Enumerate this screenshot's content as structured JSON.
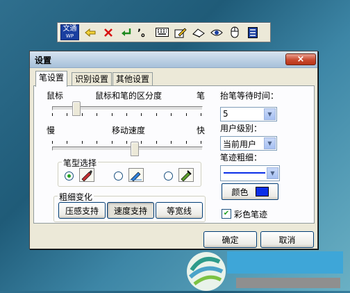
{
  "toolbar": {
    "logo_top": "文通",
    "logo_bottom": "WP",
    "icons": [
      "back-arrow-icon",
      "delete-x-icon",
      "enter-icon",
      "punctuation-icon",
      "keyboard-icon",
      "edit-icon",
      "eraser-icon",
      "eye-icon",
      "mouse-icon",
      "menu-icon"
    ]
  },
  "dialog": {
    "title": "设置",
    "close_label": "×",
    "tabs": [
      {
        "label": "笔设置",
        "active": true
      },
      {
        "label": "识别设置",
        "active": false
      },
      {
        "label": "其他设置",
        "active": false
      }
    ],
    "pen_settings": {
      "mouse_label": "鼠标",
      "distinction_label": "鼠标和笔的区分度",
      "pen_label": "笔",
      "distinction_level": 0.14,
      "slow_label": "慢",
      "speed_label": "移动速度",
      "fast_label": "快",
      "speed_level": 0.55,
      "pen_type_group": "笔型选择",
      "pen_type_selected": 0,
      "thickness_group": "粗细变化",
      "thickness_buttons": [
        "压感支持",
        "速度支持",
        "等宽线"
      ],
      "thickness_selected": 1,
      "wait_time_label": "抬笔等待时间：",
      "wait_time_value": "5",
      "user_level_label": "用户级别：",
      "user_level_value": "当前用户",
      "stroke_width_label": "笔迹粗细：",
      "color_label": "颜色",
      "color_value": "#0a2ee8",
      "colorful_stroke_label": "彩色笔迹",
      "colorful_stroke_checked": true
    },
    "ok_label": "确定",
    "cancel_label": "取消"
  }
}
